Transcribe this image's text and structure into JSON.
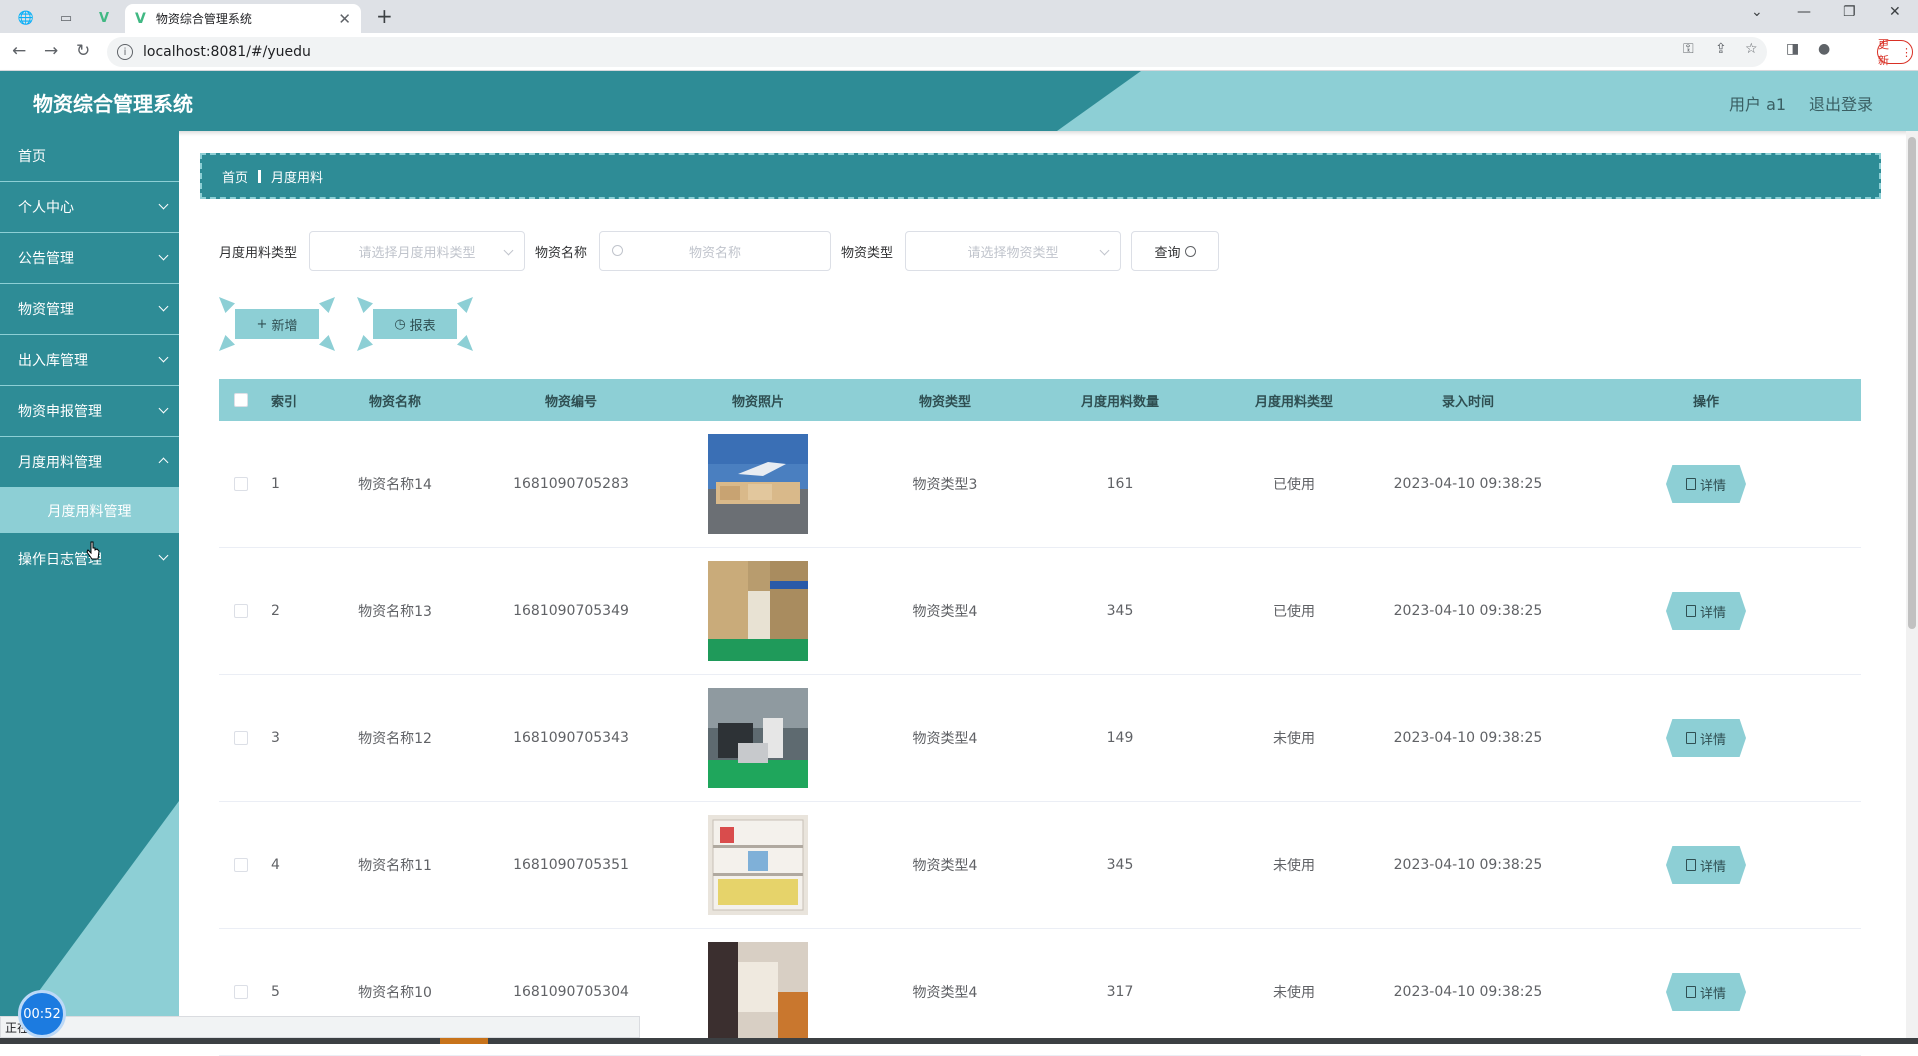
{
  "browser": {
    "tab_title": "物资综合管理系统",
    "url": "localhost:8081/#/yuedu",
    "update_label": "更新"
  },
  "header": {
    "app_title": "物资综合管理系统",
    "user": "用户 a1",
    "logout": "退出登录"
  },
  "sidebar": {
    "items": [
      {
        "label": "首页"
      },
      {
        "label": "个人中心"
      },
      {
        "label": "公告管理"
      },
      {
        "label": "物资管理"
      },
      {
        "label": "出入库管理"
      },
      {
        "label": "物资申报管理"
      },
      {
        "label": "月度用料管理"
      },
      {
        "label": "月度用料管理"
      },
      {
        "label": "操作日志管理"
      }
    ]
  },
  "breadcrumb": {
    "home": "首页",
    "current": "月度用料"
  },
  "filters": {
    "usage_type_label": "月度用料类型",
    "usage_type_placeholder": "请选择月度用料类型",
    "name_label": "物资名称",
    "name_placeholder": "物资名称",
    "goods_type_label": "物资类型",
    "goods_type_placeholder": "请选择物资类型",
    "query_label": "查询"
  },
  "actions": {
    "add_label": "新增",
    "report_label": "报表"
  },
  "table": {
    "headers": {
      "index": "索引",
      "name": "物资名称",
      "code": "物资编号",
      "photo": "物资照片",
      "type": "物资类型",
      "qty": "月度用料数量",
      "usage_type": "月度用料类型",
      "time": "录入时间",
      "op": "操作"
    },
    "detail_label": "详情",
    "rows": [
      {
        "index": "1",
        "name": "物资名称14",
        "code": "1681090705283",
        "type": "物资类型3",
        "qty": "161",
        "usage_type": "已使用",
        "time": "2023-04-10 09:38:25"
      },
      {
        "index": "2",
        "name": "物资名称13",
        "code": "1681090705349",
        "type": "物资类型4",
        "qty": "345",
        "usage_type": "已使用",
        "time": "2023-04-10 09:38:25"
      },
      {
        "index": "3",
        "name": "物资名称12",
        "code": "1681090705343",
        "type": "物资类型4",
        "qty": "149",
        "usage_type": "未使用",
        "time": "2023-04-10 09:38:25"
      },
      {
        "index": "4",
        "name": "物资名称11",
        "code": "1681090705351",
        "type": "物资类型4",
        "qty": "345",
        "usage_type": "未使用",
        "time": "2023-04-10 09:38:25"
      },
      {
        "index": "5",
        "name": "物资名称10",
        "code": "1681090705304",
        "type": "物资类型4",
        "qty": "317",
        "usage_type": "未使用",
        "time": "2023-04-10 09:38:25"
      }
    ]
  },
  "status": {
    "timer": "00:52",
    "statusbar_text": "正在"
  },
  "colors": {
    "primary": "#2e8c96",
    "accent": "#8dcfd5"
  }
}
